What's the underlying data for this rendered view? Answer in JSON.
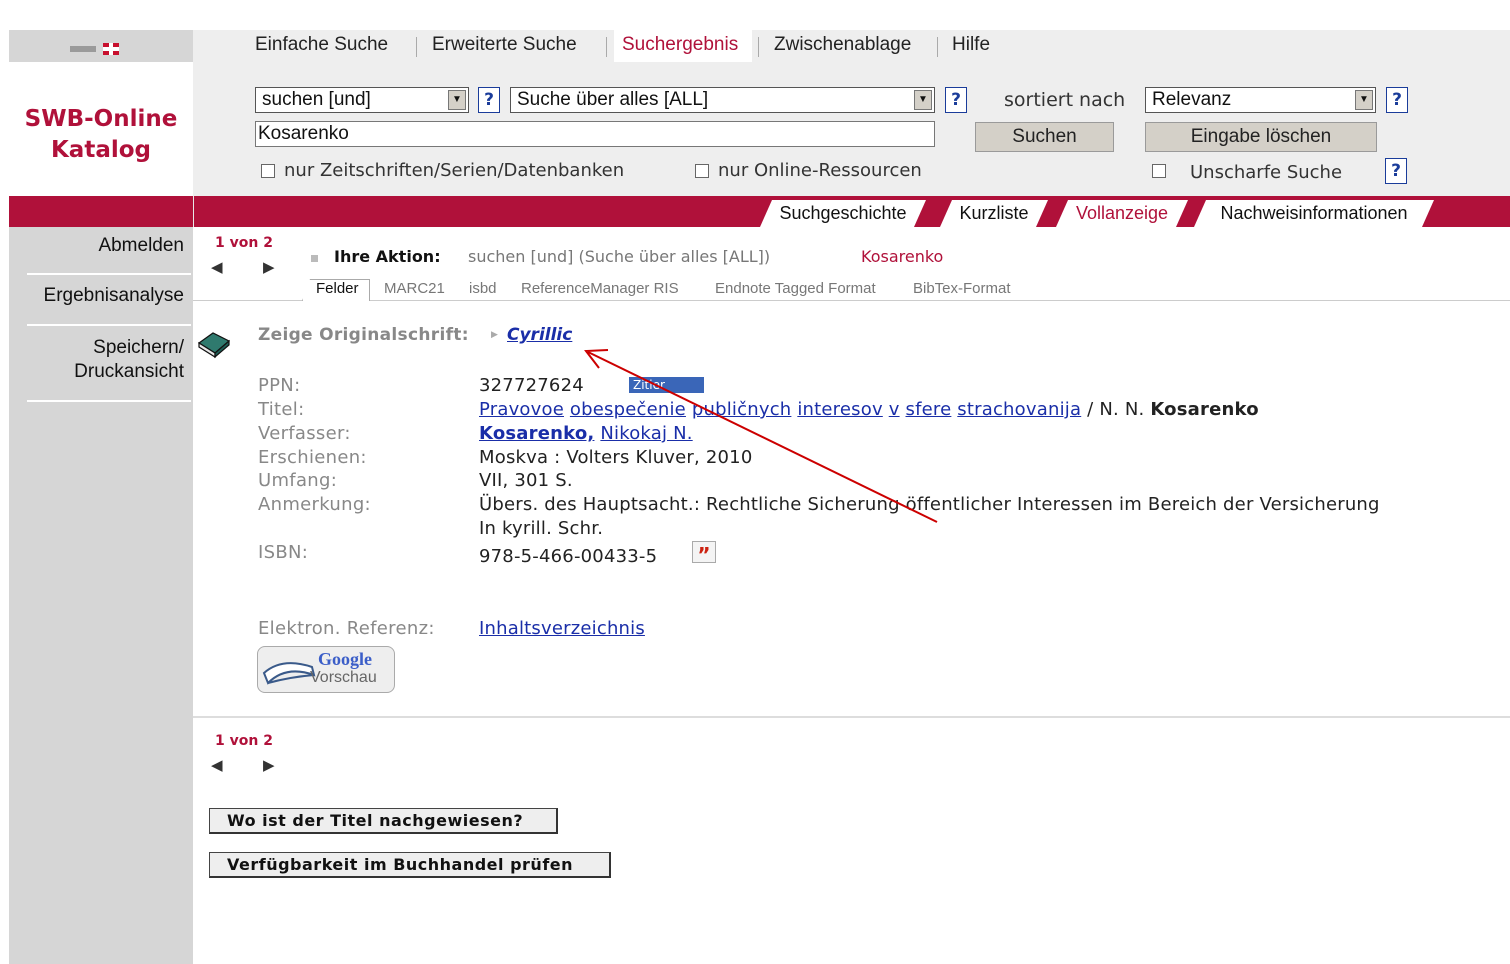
{
  "nav": {
    "items": [
      {
        "label": "Einfache Suche"
      },
      {
        "label": "Erweiterte Suche"
      },
      {
        "label": "Suchergebnis"
      },
      {
        "label": "Zwischenablage"
      },
      {
        "label": "Hilfe"
      }
    ]
  },
  "logo": {
    "line1": "SWB-Online",
    "line2": "Katalog"
  },
  "search": {
    "operator": "suchen [und]",
    "field": "Suche über alles [ALL]",
    "sort_label": "sortiert nach",
    "sort_value": "Relevanz",
    "query": "Kosarenko",
    "search_button": "Suchen",
    "clear_button": "Eingabe löschen",
    "only_journals": "nur Zeitschriften/Serien/Datenbanken",
    "only_online": "nur Online-Ressourcen",
    "fuzzy": "Unscharfe Suche",
    "help": "?"
  },
  "tabs": [
    {
      "label": "Suchgeschichte"
    },
    {
      "label": "Kurzliste"
    },
    {
      "label": "Vollanzeige"
    },
    {
      "label": "Nachweisinformationen"
    }
  ],
  "sidebar": {
    "items": [
      {
        "label": "Abmelden"
      },
      {
        "label": "Ergebnisanalyse"
      },
      {
        "label": "Speichern/"
      },
      {
        "label": "Druckansicht"
      }
    ]
  },
  "result": {
    "counter": "1 von 2",
    "action_label": "Ihre Aktion:",
    "action_text": "suchen [und] (Suche über alles [ALL])",
    "action_term": "Kosarenko",
    "subtabs": [
      "Felder",
      "MARC21",
      "isbd",
      "ReferenceManager RIS",
      "Endnote Tagged Format",
      "BibTex-Format"
    ],
    "orig_label": "Zeige Originalschrift:",
    "orig_link": "Cyrillic",
    "fields": {
      "ppn_label": "PPN:",
      "ppn": "327727624",
      "zitier": "Zitier",
      "titel_label": "Titel:",
      "titel_words": [
        "Pravovoe",
        "obespečenie",
        "publičnych",
        "interesov",
        "v",
        "sfere",
        "strachovanija"
      ],
      "titel_rest": "/ N. N.",
      "titel_author": "Kosarenko",
      "verfasser_label": "Verfasser:",
      "verfasser_bold": "Kosarenko,",
      "verfasser_rest": "Nikokaj N.",
      "erschienen_label": "Erschienen:",
      "erschienen": "Moskva : Volters Kluver, 2010",
      "umfang_label": "Umfang:",
      "umfang": "VII, 301 S.",
      "anmerkung_label": "Anmerkung:",
      "anmerkung1": "Übers. des Hauptsacht.: Rechtliche Sicherung öffentlicher Interessen im Bereich der Versicherung",
      "anmerkung2": "In kyrill. Schr.",
      "isbn_label": "ISBN:",
      "isbn": "978-5-466-00433-5",
      "elektron_label": "Elektron. Referenz:",
      "elektron_link": "Inhaltsverzeichnis"
    },
    "google": {
      "line1": "Google",
      "line2": "Vorschau"
    },
    "bottom_counter": "1 von 2",
    "btn_where": "Wo ist der Titel nachgewiesen?",
    "btn_avail": "Verfügbarkeit im Buchhandel prüfen"
  },
  "colors": {
    "brand": "#b0113a",
    "link": "#1a2ea8",
    "arrow": "#cc0000"
  }
}
